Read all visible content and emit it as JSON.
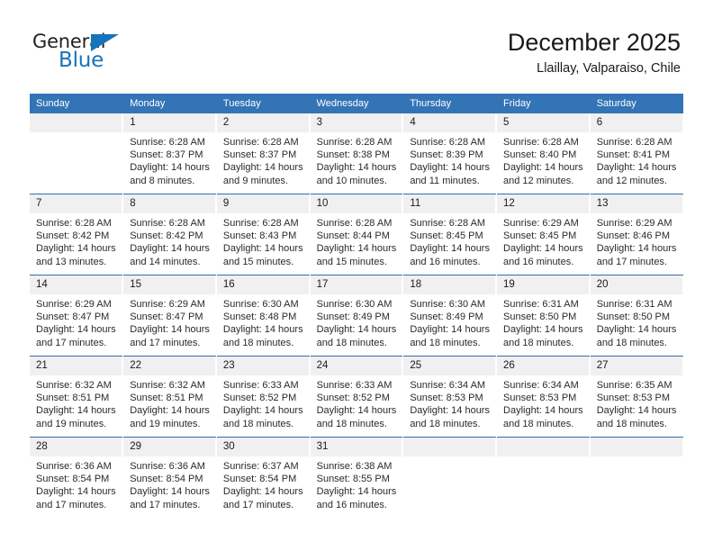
{
  "brand": {
    "name_part1": "General",
    "name_part2": "Blue",
    "accent_color": "#1574bb"
  },
  "header": {
    "title": "December 2025",
    "subtitle": "Llaillay, Valparaiso, Chile"
  },
  "calendar": {
    "header_color": "#3374b6",
    "daynum_bg": "#f0f0f0",
    "weekdays": [
      "Sunday",
      "Monday",
      "Tuesday",
      "Wednesday",
      "Thursday",
      "Friday",
      "Saturday"
    ],
    "labels": {
      "sunrise": "Sunrise:",
      "sunset": "Sunset:",
      "daylight": "Daylight:"
    },
    "weeks": [
      [
        {
          "day": "",
          "empty": true
        },
        {
          "day": "1",
          "sunrise": "Sunrise: 6:28 AM",
          "sunset": "Sunset: 8:37 PM",
          "daylight_1": "Daylight: 14 hours",
          "daylight_2": "and 8 minutes."
        },
        {
          "day": "2",
          "sunrise": "Sunrise: 6:28 AM",
          "sunset": "Sunset: 8:37 PM",
          "daylight_1": "Daylight: 14 hours",
          "daylight_2": "and 9 minutes."
        },
        {
          "day": "3",
          "sunrise": "Sunrise: 6:28 AM",
          "sunset": "Sunset: 8:38 PM",
          "daylight_1": "Daylight: 14 hours",
          "daylight_2": "and 10 minutes."
        },
        {
          "day": "4",
          "sunrise": "Sunrise: 6:28 AM",
          "sunset": "Sunset: 8:39 PM",
          "daylight_1": "Daylight: 14 hours",
          "daylight_2": "and 11 minutes."
        },
        {
          "day": "5",
          "sunrise": "Sunrise: 6:28 AM",
          "sunset": "Sunset: 8:40 PM",
          "daylight_1": "Daylight: 14 hours",
          "daylight_2": "and 12 minutes."
        },
        {
          "day": "6",
          "sunrise": "Sunrise: 6:28 AM",
          "sunset": "Sunset: 8:41 PM",
          "daylight_1": "Daylight: 14 hours",
          "daylight_2": "and 12 minutes."
        }
      ],
      [
        {
          "day": "7",
          "sunrise": "Sunrise: 6:28 AM",
          "sunset": "Sunset: 8:42 PM",
          "daylight_1": "Daylight: 14 hours",
          "daylight_2": "and 13 minutes."
        },
        {
          "day": "8",
          "sunrise": "Sunrise: 6:28 AM",
          "sunset": "Sunset: 8:42 PM",
          "daylight_1": "Daylight: 14 hours",
          "daylight_2": "and 14 minutes."
        },
        {
          "day": "9",
          "sunrise": "Sunrise: 6:28 AM",
          "sunset": "Sunset: 8:43 PM",
          "daylight_1": "Daylight: 14 hours",
          "daylight_2": "and 15 minutes."
        },
        {
          "day": "10",
          "sunrise": "Sunrise: 6:28 AM",
          "sunset": "Sunset: 8:44 PM",
          "daylight_1": "Daylight: 14 hours",
          "daylight_2": "and 15 minutes."
        },
        {
          "day": "11",
          "sunrise": "Sunrise: 6:28 AM",
          "sunset": "Sunset: 8:45 PM",
          "daylight_1": "Daylight: 14 hours",
          "daylight_2": "and 16 minutes."
        },
        {
          "day": "12",
          "sunrise": "Sunrise: 6:29 AM",
          "sunset": "Sunset: 8:45 PM",
          "daylight_1": "Daylight: 14 hours",
          "daylight_2": "and 16 minutes."
        },
        {
          "day": "13",
          "sunrise": "Sunrise: 6:29 AM",
          "sunset": "Sunset: 8:46 PM",
          "daylight_1": "Daylight: 14 hours",
          "daylight_2": "and 17 minutes."
        }
      ],
      [
        {
          "day": "14",
          "sunrise": "Sunrise: 6:29 AM",
          "sunset": "Sunset: 8:47 PM",
          "daylight_1": "Daylight: 14 hours",
          "daylight_2": "and 17 minutes."
        },
        {
          "day": "15",
          "sunrise": "Sunrise: 6:29 AM",
          "sunset": "Sunset: 8:47 PM",
          "daylight_1": "Daylight: 14 hours",
          "daylight_2": "and 17 minutes."
        },
        {
          "day": "16",
          "sunrise": "Sunrise: 6:30 AM",
          "sunset": "Sunset: 8:48 PM",
          "daylight_1": "Daylight: 14 hours",
          "daylight_2": "and 18 minutes."
        },
        {
          "day": "17",
          "sunrise": "Sunrise: 6:30 AM",
          "sunset": "Sunset: 8:49 PM",
          "daylight_1": "Daylight: 14 hours",
          "daylight_2": "and 18 minutes."
        },
        {
          "day": "18",
          "sunrise": "Sunrise: 6:30 AM",
          "sunset": "Sunset: 8:49 PM",
          "daylight_1": "Daylight: 14 hours",
          "daylight_2": "and 18 minutes."
        },
        {
          "day": "19",
          "sunrise": "Sunrise: 6:31 AM",
          "sunset": "Sunset: 8:50 PM",
          "daylight_1": "Daylight: 14 hours",
          "daylight_2": "and 18 minutes."
        },
        {
          "day": "20",
          "sunrise": "Sunrise: 6:31 AM",
          "sunset": "Sunset: 8:50 PM",
          "daylight_1": "Daylight: 14 hours",
          "daylight_2": "and 18 minutes."
        }
      ],
      [
        {
          "day": "21",
          "sunrise": "Sunrise: 6:32 AM",
          "sunset": "Sunset: 8:51 PM",
          "daylight_1": "Daylight: 14 hours",
          "daylight_2": "and 19 minutes."
        },
        {
          "day": "22",
          "sunrise": "Sunrise: 6:32 AM",
          "sunset": "Sunset: 8:51 PM",
          "daylight_1": "Daylight: 14 hours",
          "daylight_2": "and 19 minutes."
        },
        {
          "day": "23",
          "sunrise": "Sunrise: 6:33 AM",
          "sunset": "Sunset: 8:52 PM",
          "daylight_1": "Daylight: 14 hours",
          "daylight_2": "and 18 minutes."
        },
        {
          "day": "24",
          "sunrise": "Sunrise: 6:33 AM",
          "sunset": "Sunset: 8:52 PM",
          "daylight_1": "Daylight: 14 hours",
          "daylight_2": "and 18 minutes."
        },
        {
          "day": "25",
          "sunrise": "Sunrise: 6:34 AM",
          "sunset": "Sunset: 8:53 PM",
          "daylight_1": "Daylight: 14 hours",
          "daylight_2": "and 18 minutes."
        },
        {
          "day": "26",
          "sunrise": "Sunrise: 6:34 AM",
          "sunset": "Sunset: 8:53 PM",
          "daylight_1": "Daylight: 14 hours",
          "daylight_2": "and 18 minutes."
        },
        {
          "day": "27",
          "sunrise": "Sunrise: 6:35 AM",
          "sunset": "Sunset: 8:53 PM",
          "daylight_1": "Daylight: 14 hours",
          "daylight_2": "and 18 minutes."
        }
      ],
      [
        {
          "day": "28",
          "sunrise": "Sunrise: 6:36 AM",
          "sunset": "Sunset: 8:54 PM",
          "daylight_1": "Daylight: 14 hours",
          "daylight_2": "and 17 minutes."
        },
        {
          "day": "29",
          "sunrise": "Sunrise: 6:36 AM",
          "sunset": "Sunset: 8:54 PM",
          "daylight_1": "Daylight: 14 hours",
          "daylight_2": "and 17 minutes."
        },
        {
          "day": "30",
          "sunrise": "Sunrise: 6:37 AM",
          "sunset": "Sunset: 8:54 PM",
          "daylight_1": "Daylight: 14 hours",
          "daylight_2": "and 17 minutes."
        },
        {
          "day": "31",
          "sunrise": "Sunrise: 6:38 AM",
          "sunset": "Sunset: 8:55 PM",
          "daylight_1": "Daylight: 14 hours",
          "daylight_2": "and 16 minutes."
        },
        {
          "day": "",
          "empty": true
        },
        {
          "day": "",
          "empty": true
        },
        {
          "day": "",
          "empty": true
        }
      ]
    ]
  }
}
